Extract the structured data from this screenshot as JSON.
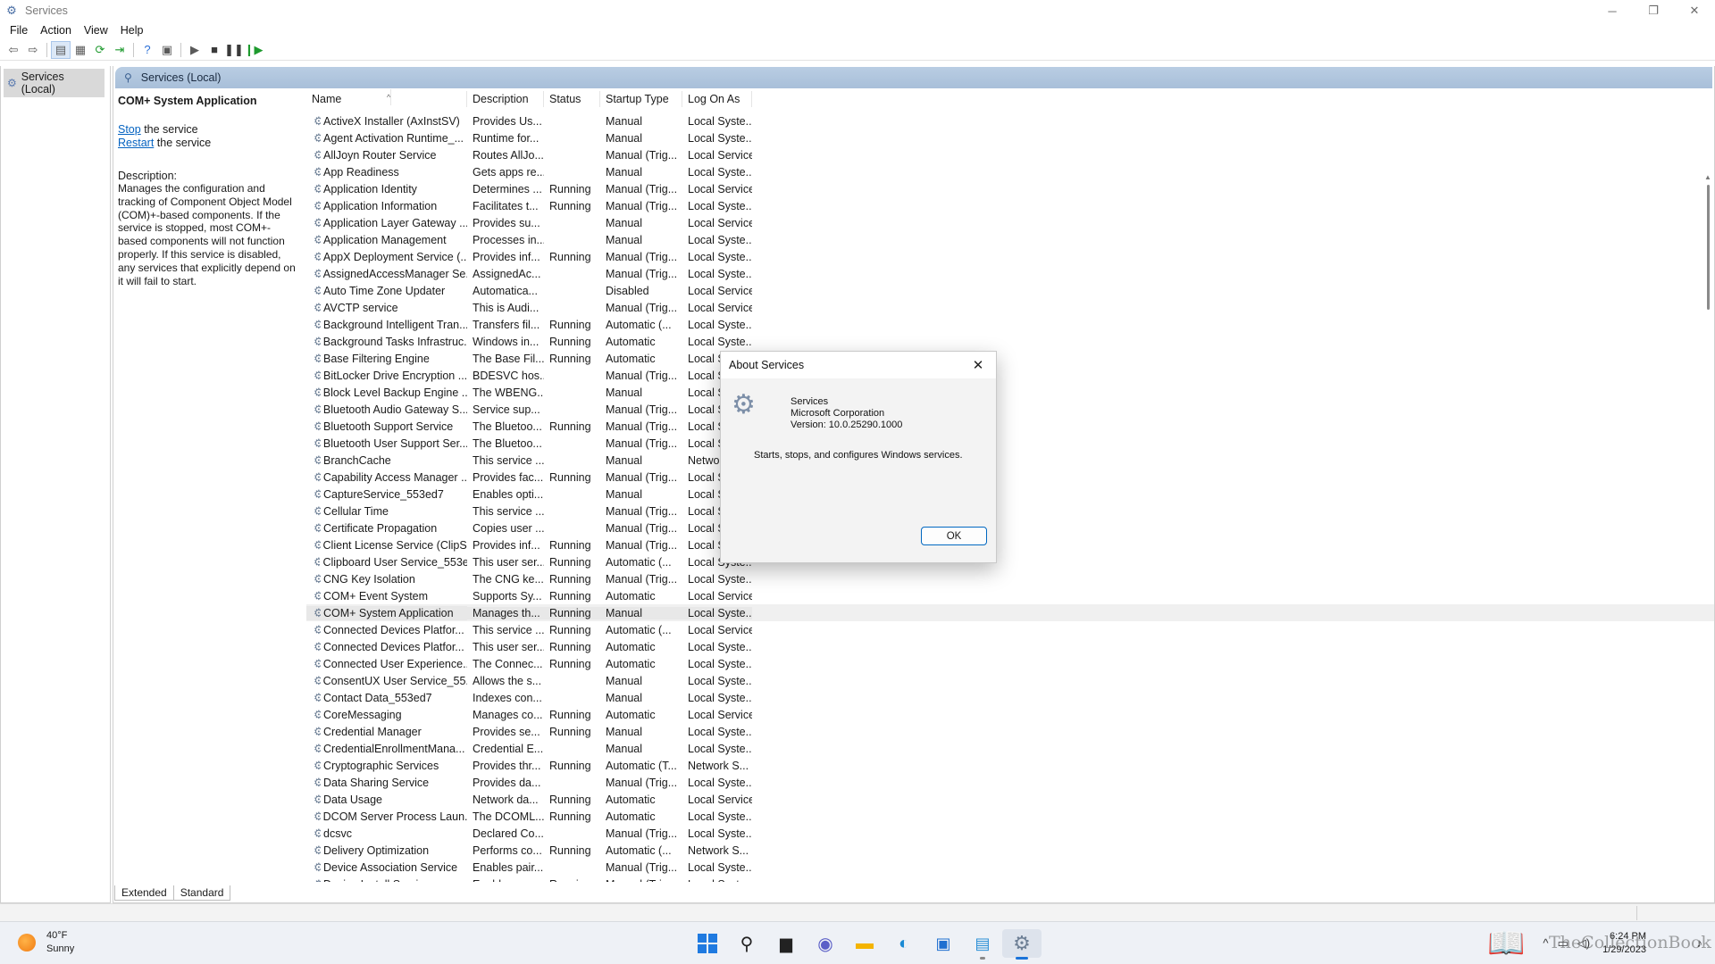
{
  "window": {
    "title": "Services",
    "controls": {
      "minimize": "─",
      "maximize": "❐",
      "close": "✕"
    }
  },
  "menu": [
    "File",
    "Action",
    "View",
    "Help"
  ],
  "tree": {
    "root": "Services (Local)"
  },
  "main": {
    "header": "Services (Local)",
    "selected_service": "COM+ System Application",
    "stop_link": "Stop",
    "stop_text": " the service",
    "restart_link": "Restart",
    "restart_text": " the service",
    "description_label": "Description:",
    "description": "Manages the configuration and tracking of Component Object Model (COM)+-based components. If the service is stopped, most COM+-based components will not function properly. If this service is disabled, any services that explicitly depend on it will fail to start."
  },
  "columns": {
    "name": "Name",
    "description": "Description",
    "status": "Status",
    "startup": "Startup Type",
    "logon": "Log On As"
  },
  "services": [
    [
      "ActiveX Installer (AxInstSV)",
      "Provides Us...",
      "",
      "Manual",
      "Local Syste..."
    ],
    [
      "Agent Activation Runtime_...",
      "Runtime for...",
      "",
      "Manual",
      "Local Syste..."
    ],
    [
      "AllJoyn Router Service",
      "Routes AllJo...",
      "",
      "Manual (Trig...",
      "Local Service"
    ],
    [
      "App Readiness",
      "Gets apps re...",
      "",
      "Manual",
      "Local Syste..."
    ],
    [
      "Application Identity",
      "Determines ...",
      "Running",
      "Manual (Trig...",
      "Local Service"
    ],
    [
      "Application Information",
      "Facilitates t...",
      "Running",
      "Manual (Trig...",
      "Local Syste..."
    ],
    [
      "Application Layer Gateway ...",
      "Provides su...",
      "",
      "Manual",
      "Local Service"
    ],
    [
      "Application Management",
      "Processes in...",
      "",
      "Manual",
      "Local Syste..."
    ],
    [
      "AppX Deployment Service (...",
      "Provides inf...",
      "Running",
      "Manual (Trig...",
      "Local Syste..."
    ],
    [
      "AssignedAccessManager Se...",
      "AssignedAc...",
      "",
      "Manual (Trig...",
      "Local Syste..."
    ],
    [
      "Auto Time Zone Updater",
      "Automatica...",
      "",
      "Disabled",
      "Local Service"
    ],
    [
      "AVCTP service",
      "This is Audi...",
      "",
      "Manual (Trig...",
      "Local Service"
    ],
    [
      "Background Intelligent Tran...",
      "Transfers fil...",
      "Running",
      "Automatic (...",
      "Local Syste..."
    ],
    [
      "Background Tasks Infrastruc...",
      "Windows in...",
      "Running",
      "Automatic",
      "Local Syste..."
    ],
    [
      "Base Filtering Engine",
      "The Base Fil...",
      "Running",
      "Automatic",
      "Local Se"
    ],
    [
      "BitLocker Drive Encryption ...",
      "BDESVC hos...",
      "",
      "Manual (Trig...",
      "Local Sy"
    ],
    [
      "Block Level Backup Engine ...",
      "The WBENG...",
      "",
      "Manual",
      "Local Sy"
    ],
    [
      "Bluetooth Audio Gateway S...",
      "Service sup...",
      "",
      "Manual (Trig...",
      "Local Se"
    ],
    [
      "Bluetooth Support Service",
      "The Bluetoo...",
      "Running",
      "Manual (Trig...",
      "Local Se"
    ],
    [
      "Bluetooth User Support Ser...",
      "The Bluetoo...",
      "",
      "Manual (Trig...",
      "Local Sy"
    ],
    [
      "BranchCache",
      "This service ...",
      "",
      "Manual",
      "Network"
    ],
    [
      "Capability Access Manager ...",
      "Provides fac...",
      "Running",
      "Manual (Trig...",
      "Local Sy"
    ],
    [
      "CaptureService_553ed7",
      "Enables opti...",
      "",
      "Manual",
      "Local Sy"
    ],
    [
      "Cellular Time",
      "This service ...",
      "",
      "Manual (Trig...",
      "Local Se"
    ],
    [
      "Certificate Propagation",
      "Copies user ...",
      "",
      "Manual (Trig...",
      "Local Sy"
    ],
    [
      "Client License Service (ClipS...",
      "Provides inf...",
      "Running",
      "Manual (Trig...",
      "Local Sy"
    ],
    [
      "Clipboard User Service_553e...",
      "This user ser...",
      "Running",
      "Automatic (...",
      "Local Syste..."
    ],
    [
      "CNG Key Isolation",
      "The CNG ke...",
      "Running",
      "Manual (Trig...",
      "Local Syste..."
    ],
    [
      "COM+ Event System",
      "Supports Sy...",
      "Running",
      "Automatic",
      "Local Service"
    ],
    [
      "COM+ System Application",
      "Manages th...",
      "Running",
      "Manual",
      "Local Syste..."
    ],
    [
      "Connected Devices Platfor...",
      "This service ...",
      "Running",
      "Automatic (...",
      "Local Service"
    ],
    [
      "Connected Devices Platfor...",
      "This user ser...",
      "Running",
      "Automatic",
      "Local Syste..."
    ],
    [
      "Connected User Experience...",
      "The Connec...",
      "Running",
      "Automatic",
      "Local Syste..."
    ],
    [
      "ConsentUX User Service_55...",
      "Allows the s...",
      "",
      "Manual",
      "Local Syste..."
    ],
    [
      "Contact Data_553ed7",
      "Indexes con...",
      "",
      "Manual",
      "Local Syste..."
    ],
    [
      "CoreMessaging",
      "Manages co...",
      "Running",
      "Automatic",
      "Local Service"
    ],
    [
      "Credential Manager",
      "Provides se...",
      "Running",
      "Manual",
      "Local Syste..."
    ],
    [
      "CredentialEnrollmentMana...",
      "Credential E...",
      "",
      "Manual",
      "Local Syste..."
    ],
    [
      "Cryptographic Services",
      "Provides thr...",
      "Running",
      "Automatic (T...",
      "Network S..."
    ],
    [
      "Data Sharing Service",
      "Provides da...",
      "",
      "Manual (Trig...",
      "Local Syste..."
    ],
    [
      "Data Usage",
      "Network da...",
      "Running",
      "Automatic",
      "Local Service"
    ],
    [
      "DCOM Server Process Laun...",
      "The DCOML...",
      "Running",
      "Automatic",
      "Local Syste..."
    ],
    [
      "dcsvc",
      "Declared Co...",
      "",
      "Manual (Trig...",
      "Local Syste..."
    ],
    [
      "Delivery Optimization",
      "Performs co...",
      "Running",
      "Automatic (...",
      "Network S..."
    ],
    [
      "Device Association Service",
      "Enables pair...",
      "",
      "Manual (Trig...",
      "Local Syste..."
    ],
    [
      "Device Install Service",
      "Enables a c...",
      "Running",
      "Manual (Trig...",
      "Local Syste..."
    ]
  ],
  "selected_index": 29,
  "tabs": [
    "Extended",
    "Standard"
  ],
  "dialog": {
    "title": "About Services",
    "app_name": "Services",
    "company": "Microsoft Corporation",
    "version": "Version: 10.0.25290.1000",
    "summary": "Starts, stops, and configures Windows services.",
    "ok": "OK"
  },
  "taskbar": {
    "weather_temp": "40°F",
    "weather_cond": "Sunny",
    "time": "6:24 PM",
    "date": "1/29/2023",
    "watermark": "TheCollectionBook"
  }
}
